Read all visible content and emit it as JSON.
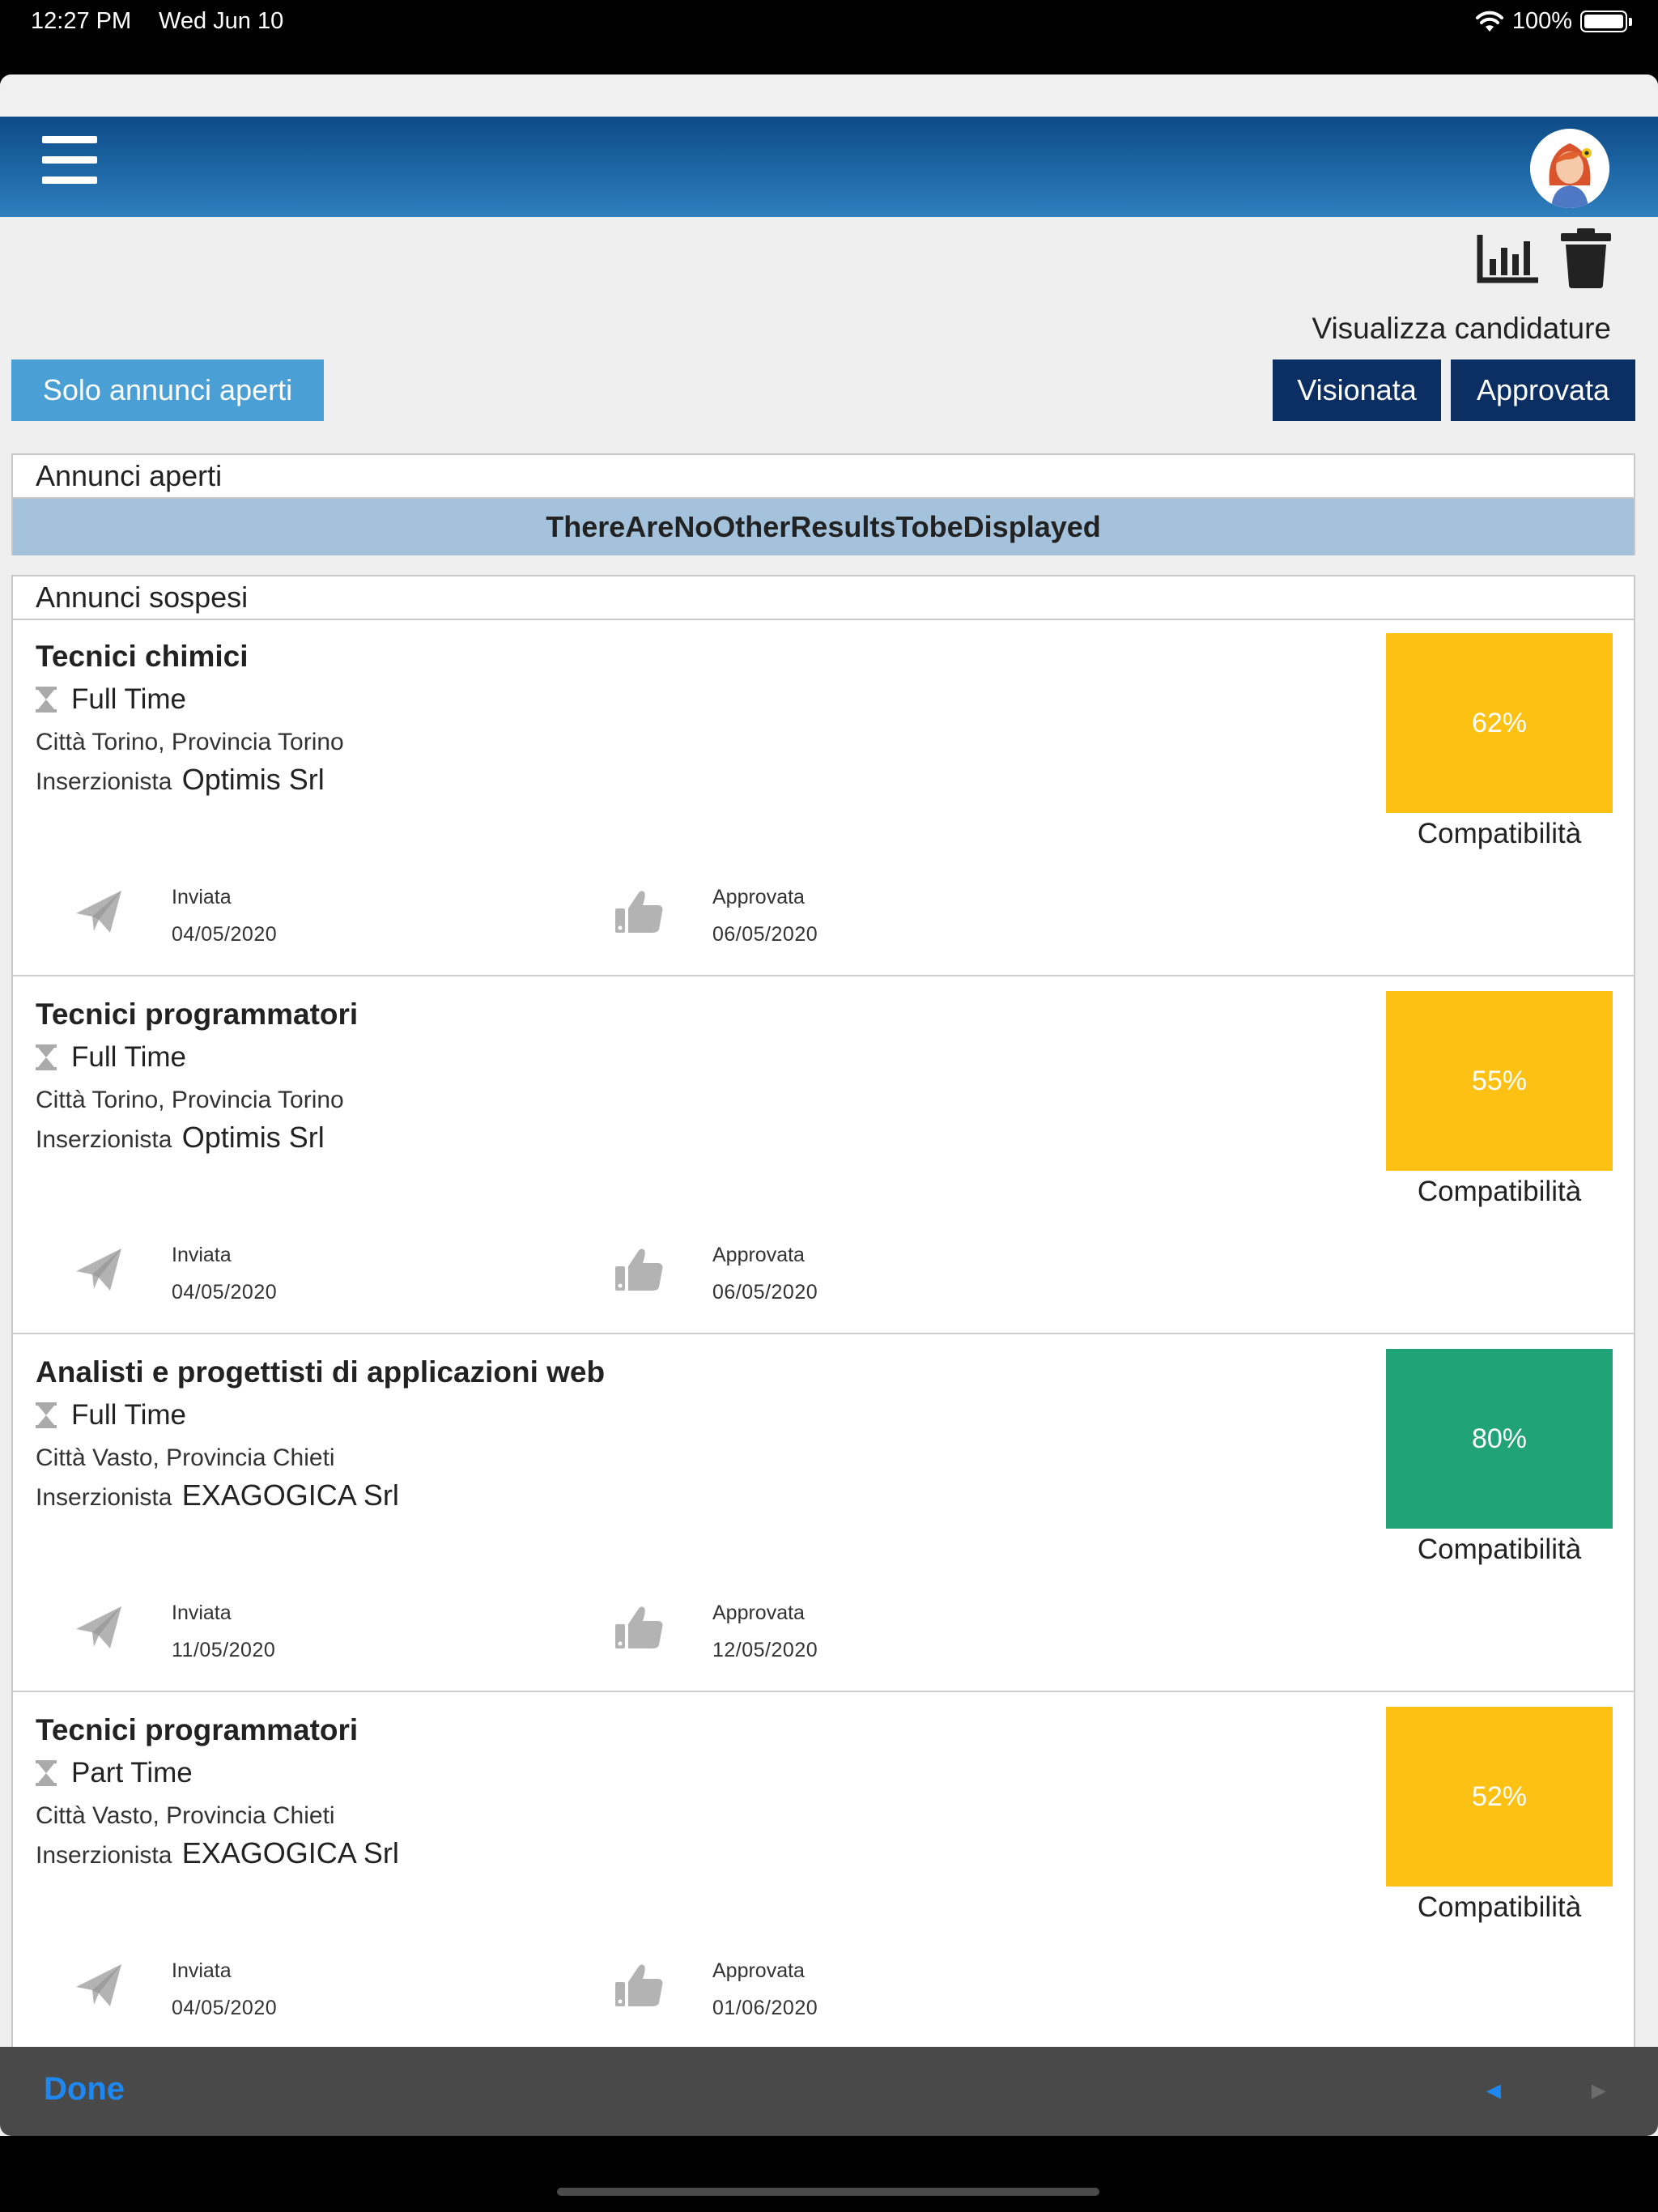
{
  "status_bar": {
    "time": "12:27 PM",
    "date": "Wed Jun 10",
    "battery": "100%"
  },
  "header": {
    "menu_icon": "hamburger-icon",
    "avatar_icon": "avatar-icon"
  },
  "toolbar": {
    "chart_icon": "bar-chart-icon",
    "trash_icon": "trash-icon",
    "visualizza_label": "Visualizza candidature"
  },
  "filters": {
    "solo_annunci_aperti": "Solo annunci aperti",
    "visionata": "Visionata",
    "approvata": "Approvata"
  },
  "colors": {
    "header_blue": "#1e67a6",
    "filter_light": "#4a9fd4",
    "filter_dark": "#0b2f63",
    "compat_yellow": "#fdc113",
    "compat_green": "#1fa377",
    "no_results_bg": "#a4c2dc"
  },
  "annunci_aperti": {
    "title": "Annunci aperti",
    "no_results": "ThereAreNoOtherResultsTobeDisplayed"
  },
  "annunci_sospesi": {
    "title": "Annunci sospesi",
    "cards": [
      {
        "title": "Tecnici chimici",
        "time": "Full Time",
        "city": "Città Torino, Provincia Torino",
        "advertiser_label": "Inserzionista",
        "company": "Optimis Srl",
        "compat": "62%",
        "compat_label": "Compatibilità",
        "compat_color": "#fdc113",
        "sent_label": "Inviata",
        "sent_date": "04/05/2020",
        "approved_label": "Approvata",
        "approved_date": "06/05/2020"
      },
      {
        "title": "Tecnici programmatori",
        "time": "Full Time",
        "city": "Città Torino, Provincia Torino",
        "advertiser_label": "Inserzionista",
        "company": "Optimis Srl",
        "compat": "55%",
        "compat_label": "Compatibilità",
        "compat_color": "#fdc113",
        "sent_label": "Inviata",
        "sent_date": "04/05/2020",
        "approved_label": "Approvata",
        "approved_date": "06/05/2020"
      },
      {
        "title": "Analisti e progettisti di applicazioni web",
        "time": "Full Time",
        "city": "Città Vasto, Provincia Chieti",
        "advertiser_label": "Inserzionista",
        "company": "EXAGOGICA Srl",
        "compat": "80%",
        "compat_label": "Compatibilità",
        "compat_color": "#1fa377",
        "sent_label": "Inviata",
        "sent_date": "11/05/2020",
        "approved_label": "Approvata",
        "approved_date": "12/05/2020"
      },
      {
        "title": "Tecnici programmatori",
        "time": "Part Time",
        "city": "Città Vasto, Provincia Chieti",
        "advertiser_label": "Inserzionista",
        "company": "EXAGOGICA Srl",
        "compat": "52%",
        "compat_label": "Compatibilità",
        "compat_color": "#fdc113",
        "sent_label": "Inviata",
        "sent_date": "04/05/2020",
        "approved_label": "Approvata",
        "approved_date": "01/06/2020"
      }
    ]
  },
  "accessory_bar": {
    "done": "Done",
    "prev": "◄",
    "next": "►"
  }
}
